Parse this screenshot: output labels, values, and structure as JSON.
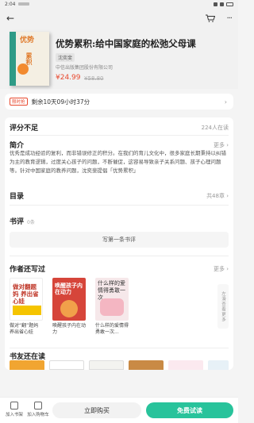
{
  "status": {
    "time": "2:04"
  },
  "topbar": {
    "back_icon": "←",
    "cart_icon": "cart-icon",
    "more_icon": "···"
  },
  "book": {
    "cover_text_1": "优势",
    "cover_text_2": "累积",
    "title": "优势累积:给中国家庭的松弛父母课",
    "author": "沈奕斐",
    "publisher": "中信出版集团股份有限公司",
    "price": "¥24.99",
    "old_price": "¥58.80"
  },
  "promo": {
    "badge": "限时抢",
    "text": "剩余10天09小时37分",
    "arrow": "›"
  },
  "rating": {
    "label": "评分不足",
    "readers": "224人在读"
  },
  "intro": {
    "title": "简介",
    "more": "更多 ›",
    "text": "优秀是成功经验的复利，而非错误修正的积分。在我们的育儿文化中，很多家庭长期秉持以纠错为主的教育逻辑，过度关心孩子的问题，不断催促，这容易导致亲子关系问题、孩子心理问题等。针对中国家庭的教养问题，沈奕斐提倡「优势累积」"
  },
  "toc": {
    "title": "目录",
    "count": "共48章 ›"
  },
  "reviews": {
    "title": "书评",
    "count": "0条",
    "write_button": "写第一条书评"
  },
  "works": {
    "title": "作者还写过",
    "more": "更多 ›",
    "side_more": "左滑查看更多",
    "items": [
      {
        "cover": "做对翻题妈 养出省心娃",
        "name": "做对“翻”题妈 养出省心娃"
      },
      {
        "cover": "唤醒孩子内在动力",
        "name": "唤醒孩子内在动力"
      },
      {
        "cover": "什么样的爱情得勇敢一次",
        "name": "什么样的爱情得勇敢一次..."
      }
    ]
  },
  "friends": {
    "title": "书友还在读"
  },
  "bottom": {
    "shelf_label": "加入书架",
    "cart_label": "加入购物车",
    "buy_label": "立即购买",
    "trial_label": "免费试读"
  }
}
